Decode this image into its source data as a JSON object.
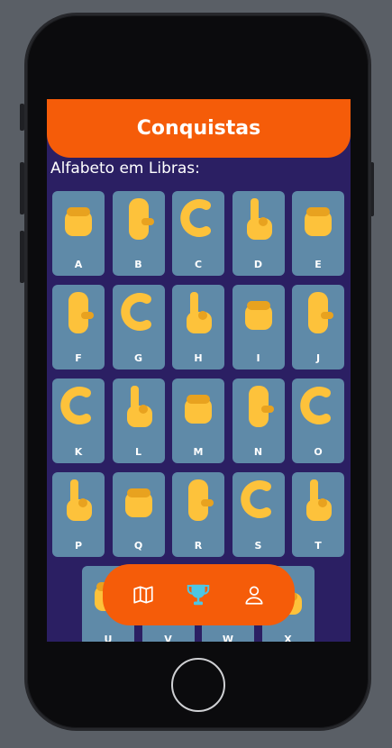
{
  "header": {
    "title": "Conquistas"
  },
  "section": {
    "label": "Alfabeto em Libras:"
  },
  "alphabet": [
    "A",
    "B",
    "C",
    "D",
    "E",
    "F",
    "G",
    "H",
    "I",
    "J",
    "K",
    "L",
    "M",
    "N",
    "O",
    "P",
    "Q",
    "R",
    "S",
    "T",
    "U",
    "V",
    "W",
    "X"
  ],
  "nav": {
    "items": [
      "map-icon",
      "trophy-icon",
      "user-icon"
    ],
    "active": "trophy-icon"
  },
  "colors": {
    "accent": "#f55c09",
    "background": "#2b1f63",
    "card": "#5f8aa8",
    "hand": "#fdc23b",
    "active_icon": "#4dc6e4"
  }
}
